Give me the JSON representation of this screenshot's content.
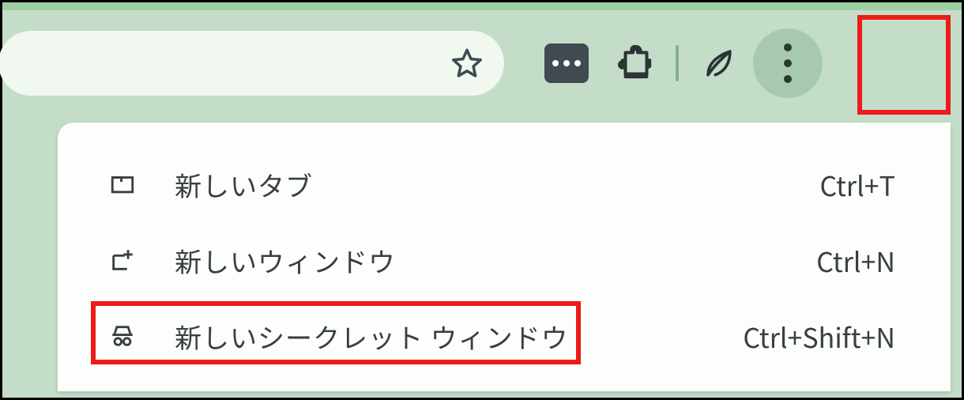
{
  "toolbar": {
    "bookmark_star": "star",
    "password_manager": "password",
    "extensions": "extensions",
    "energy_saver": "leaf",
    "menu": "more"
  },
  "menu": {
    "items": [
      {
        "icon": "tab",
        "label": "新しいタブ",
        "shortcut": "Ctrl+T"
      },
      {
        "icon": "window",
        "label": "新しいウィンドウ",
        "shortcut": "Ctrl+N"
      },
      {
        "icon": "incognito",
        "label": "新しいシークレット ウィンドウ",
        "shortcut": "Ctrl+Shift+N"
      }
    ]
  },
  "highlights": {
    "menu_button": true,
    "incognito_item": true
  }
}
